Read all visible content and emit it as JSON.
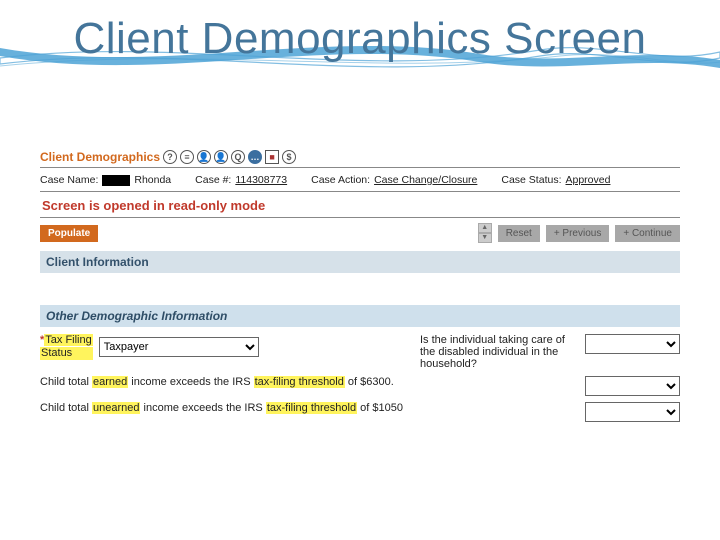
{
  "title": "Client Demographics Screen",
  "panel": {
    "heading": "Client Demographics",
    "icons": [
      "?",
      "≡",
      "👤",
      "👤",
      "Q",
      "…",
      "■",
      "$"
    ]
  },
  "caseRow": {
    "caseNameLabel": "Case Name:",
    "caseNameValue": "Rhonda",
    "caseNumLabel": "Case #:",
    "caseNumValue": "114308773",
    "caseActionLabel": "Case Action:",
    "caseActionValue": "Case Change/Closure",
    "caseStatusLabel": "Case Status:",
    "caseStatusValue": "Approved"
  },
  "readonlyNotice": "Screen is opened in read-only mode",
  "buttons": {
    "populate": "Populate",
    "reset": "Reset",
    "previous": "+ Previous",
    "continue": "+ Continue"
  },
  "sections": {
    "clientInfo": "Client Information",
    "otherDemo": "Other Demographic Information"
  },
  "fields": {
    "taxFilingLabel1": "Tax Filing",
    "taxFilingLabel2": "Status",
    "taxFilingValue": "Taxpayer",
    "disabledCareQuestion": "Is the individual taking care of the disabled individual in the household?",
    "childEarned_pre": "Child total ",
    "childEarned_hl1": "earned",
    "childEarned_mid": " income exceeds the IRS ",
    "childEarned_hl2": "tax-filing threshold",
    "childEarned_post": " of $6300.",
    "childUnearned_pre": "Child total ",
    "childUnearned_hl1": "unearned",
    "childUnearned_mid": " income exceeds the IRS ",
    "childUnearned_hl2": "tax-filing threshold",
    "childUnearned_post": " of $1050"
  }
}
